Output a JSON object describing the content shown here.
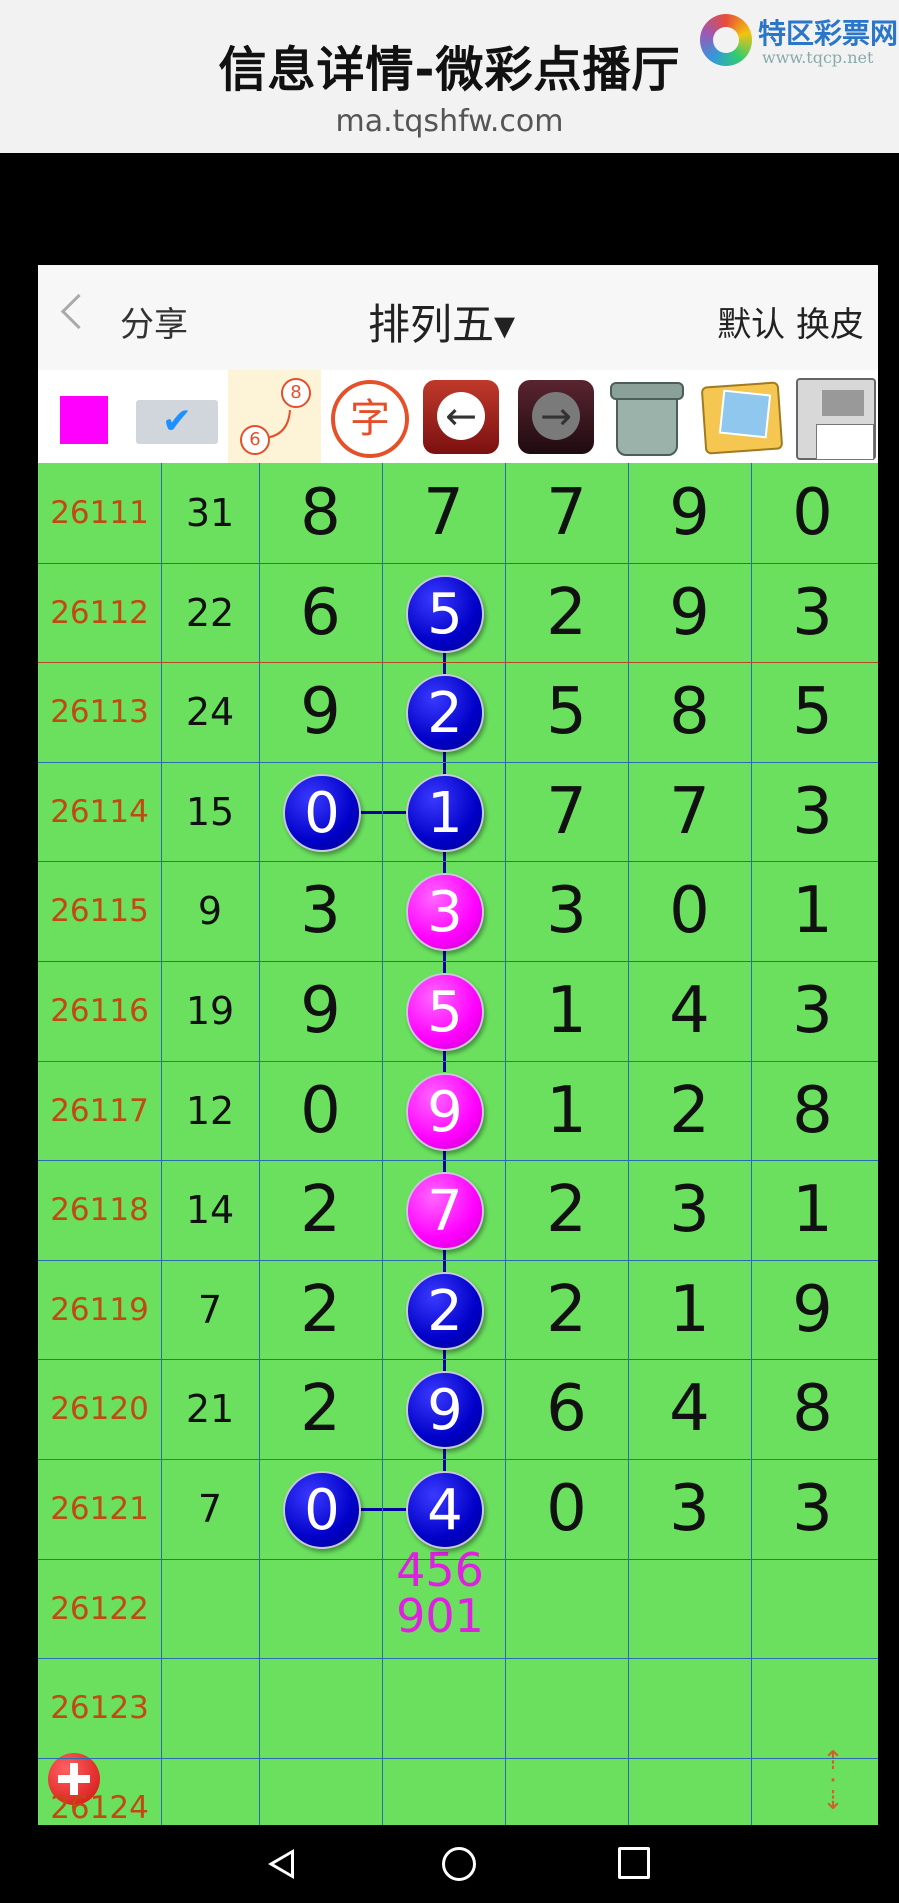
{
  "top_banner": {
    "title": "信息详情-微彩点播厅",
    "url": "ma.tqshfw.com",
    "logo_text": "特区彩票网",
    "logo_sub": "www.tqcp.net"
  },
  "navbar": {
    "share_label": "分享",
    "title": "排列五▾",
    "right_label": "默认 换皮"
  },
  "toolbar": {
    "route_from": "6",
    "route_to": "8",
    "zi_label": "字",
    "prev_arrow": "←",
    "next_arrow": "→",
    "check": "✔"
  },
  "rows": [
    {
      "issue": "26111",
      "sum": "31",
      "d": [
        "8",
        "7",
        "7",
        "9",
        "0"
      ]
    },
    {
      "issue": "26112",
      "sum": "22",
      "d": [
        "6",
        "5",
        "2",
        "9",
        "3"
      ]
    },
    {
      "issue": "26113",
      "sum": "24",
      "d": [
        "9",
        "2",
        "5",
        "8",
        "5"
      ]
    },
    {
      "issue": "26114",
      "sum": "15",
      "d": [
        "0",
        "1",
        "7",
        "7",
        "3"
      ]
    },
    {
      "issue": "26115",
      "sum": "9",
      "d": [
        "3",
        "3",
        "3",
        "0",
        "1"
      ]
    },
    {
      "issue": "26116",
      "sum": "19",
      "d": [
        "9",
        "5",
        "1",
        "4",
        "3"
      ]
    },
    {
      "issue": "26117",
      "sum": "12",
      "d": [
        "0",
        "9",
        "1",
        "2",
        "8"
      ]
    },
    {
      "issue": "26118",
      "sum": "14",
      "d": [
        "2",
        "7",
        "2",
        "3",
        "1"
      ]
    },
    {
      "issue": "26119",
      "sum": "7",
      "d": [
        "2",
        "2",
        "2",
        "1",
        "9"
      ]
    },
    {
      "issue": "26120",
      "sum": "21",
      "d": [
        "2",
        "9",
        "6",
        "4",
        "8"
      ]
    },
    {
      "issue": "26121",
      "sum": "7",
      "d": [
        "0",
        "4",
        "0",
        "3",
        "3"
      ]
    },
    {
      "issue": "26122",
      "sum": "",
      "d": [
        "",
        "",
        "",
        "",
        ""
      ]
    },
    {
      "issue": "26123",
      "sum": "",
      "d": [
        "",
        "",
        "",
        "",
        ""
      ]
    },
    {
      "issue": "26124",
      "sum": "",
      "d": [
        "",
        "",
        "",
        "",
        ""
      ]
    }
  ],
  "balls": [
    {
      "row": 1,
      "col": 1,
      "color": "blue"
    },
    {
      "row": 2,
      "col": 1,
      "color": "blue"
    },
    {
      "row": 3,
      "col": 0,
      "color": "blue"
    },
    {
      "row": 3,
      "col": 1,
      "color": "blue"
    },
    {
      "row": 4,
      "col": 1,
      "color": "magenta"
    },
    {
      "row": 5,
      "col": 1,
      "color": "magenta"
    },
    {
      "row": 6,
      "col": 1,
      "color": "magenta"
    },
    {
      "row": 7,
      "col": 1,
      "color": "magenta"
    },
    {
      "row": 8,
      "col": 1,
      "color": "blue"
    },
    {
      "row": 9,
      "col": 1,
      "color": "blue"
    },
    {
      "row": 10,
      "col": 0,
      "color": "blue"
    },
    {
      "row": 10,
      "col": 1,
      "color": "blue"
    }
  ],
  "prediction": {
    "line1": "456",
    "line2": "901"
  },
  "colors": {
    "grid_bg": "#6be05f",
    "ball_blue": "#0000c8",
    "ball_magenta": "#ff00ff",
    "issue_text": "#c04a10",
    "prediction_text": "#e020e0"
  }
}
